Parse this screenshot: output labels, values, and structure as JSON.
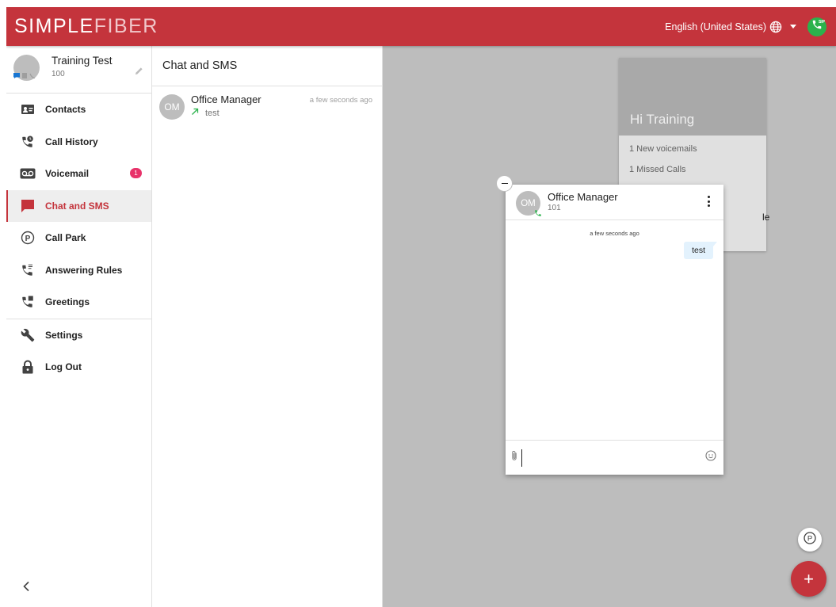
{
  "header": {
    "logo_part1": "SIMPLE",
    "logo_part2": "FIBER",
    "language": "English (United States)",
    "icons": [
      "globe-icon",
      "chevron-down-icon",
      "sip-phone-icon"
    ],
    "sip_label": "SIP",
    "colors": {
      "brand": "#c4343c",
      "sip_status": "#2bb24c"
    }
  },
  "profile": {
    "name": "Training Test",
    "extension": "100"
  },
  "sidebar": {
    "items": [
      {
        "label": "Contacts",
        "icon": "contacts-icon"
      },
      {
        "label": "Call History",
        "icon": "call-history-icon"
      },
      {
        "label": "Voicemail",
        "icon": "voicemail-icon",
        "badge": "1"
      },
      {
        "label": "Chat and SMS",
        "icon": "chat-icon",
        "active": true
      },
      {
        "label": "Call Park",
        "icon": "call-park-icon"
      },
      {
        "label": "Answering Rules",
        "icon": "answering-rules-icon"
      },
      {
        "label": "Greetings",
        "icon": "greetings-icon"
      },
      {
        "label": "Settings",
        "icon": "wrench-icon"
      },
      {
        "label": "Log Out",
        "icon": "lock-icon"
      }
    ]
  },
  "chatlist": {
    "title": "Chat and SMS",
    "conversations": [
      {
        "initials": "OM",
        "name": "Office Manager",
        "time": "a few seconds ago",
        "preview": "test"
      }
    ]
  },
  "welcome": {
    "greeting": "Hi Training",
    "lines": [
      "1 New voicemails",
      "1 Missed Calls"
    ],
    "partial_text": "le"
  },
  "chat_window": {
    "initials": "OM",
    "name": "Office Manager",
    "extension": "101",
    "timestamp": "a few seconds ago",
    "messages": [
      {
        "text": "test",
        "direction": "outgoing"
      }
    ],
    "input_value": "",
    "input_placeholder": ""
  },
  "fabs": {
    "add_label": "+"
  }
}
